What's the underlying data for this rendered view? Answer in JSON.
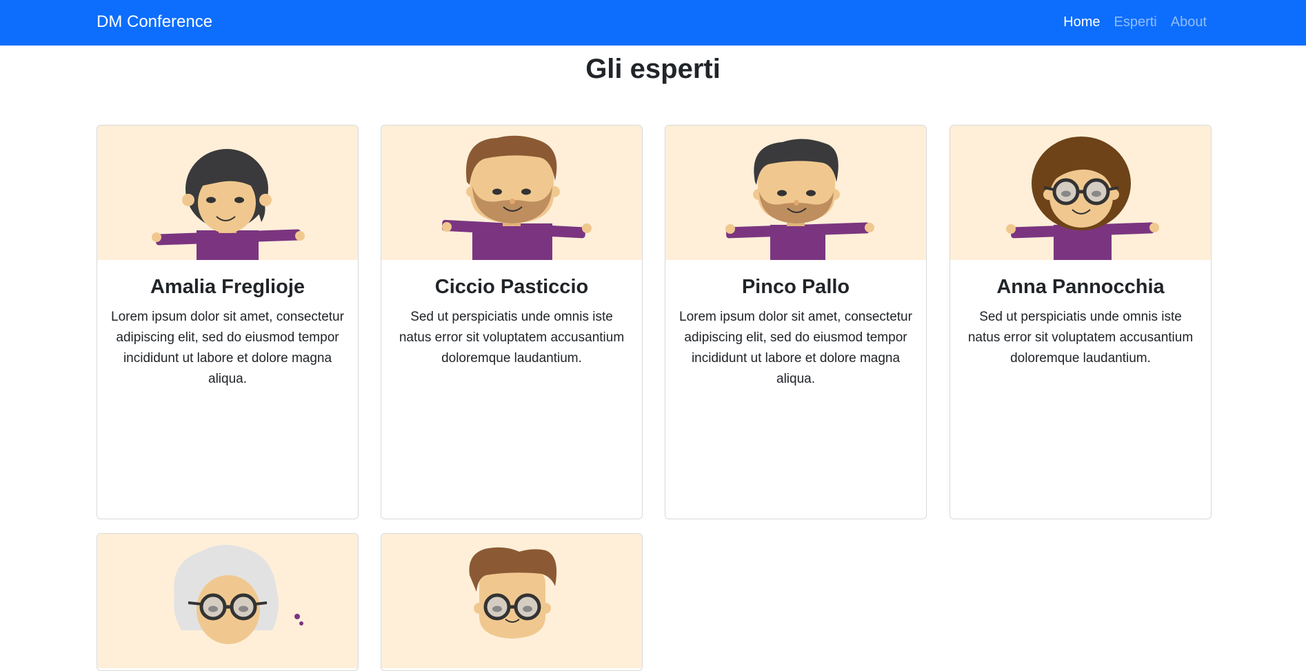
{
  "navbar": {
    "brand": "DM Conference",
    "links": [
      "Home",
      "Esperti",
      "About"
    ]
  },
  "page": {
    "title": "Gli esperti"
  },
  "experts": [
    {
      "name": "Amalia Freglioje",
      "description": "Lorem ipsum dolor sit amet, consectetur adipiscing elit, sed do eiusmod tempor incididunt ut labore et dolore magna aliqua."
    },
    {
      "name": "Ciccio Pasticcio",
      "description": "Sed ut perspiciatis unde omnis iste natus error sit voluptatem accusantium doloremque laudantium."
    },
    {
      "name": "Pinco Pallo",
      "description": "Lorem ipsum dolor sit amet, consectetur adipiscing elit, sed do eiusmod tempor incididunt ut labore et dolore magna aliqua."
    },
    {
      "name": "Anna Pannocchia",
      "description": "Sed ut perspiciatis unde omnis iste natus error sit voluptatem accusantium doloremque laudantium."
    }
  ],
  "colors": {
    "navbar": "#0d6efd",
    "card_image_bg": "#ffefd9",
    "shirt": "#7b3580",
    "skin": "#f0c88f",
    "hair_dark": "#3a3a3c",
    "hair_brown": "#8b5a34",
    "hair_auburn": "#6e4318",
    "hair_grey": "#e2e2e2"
  }
}
